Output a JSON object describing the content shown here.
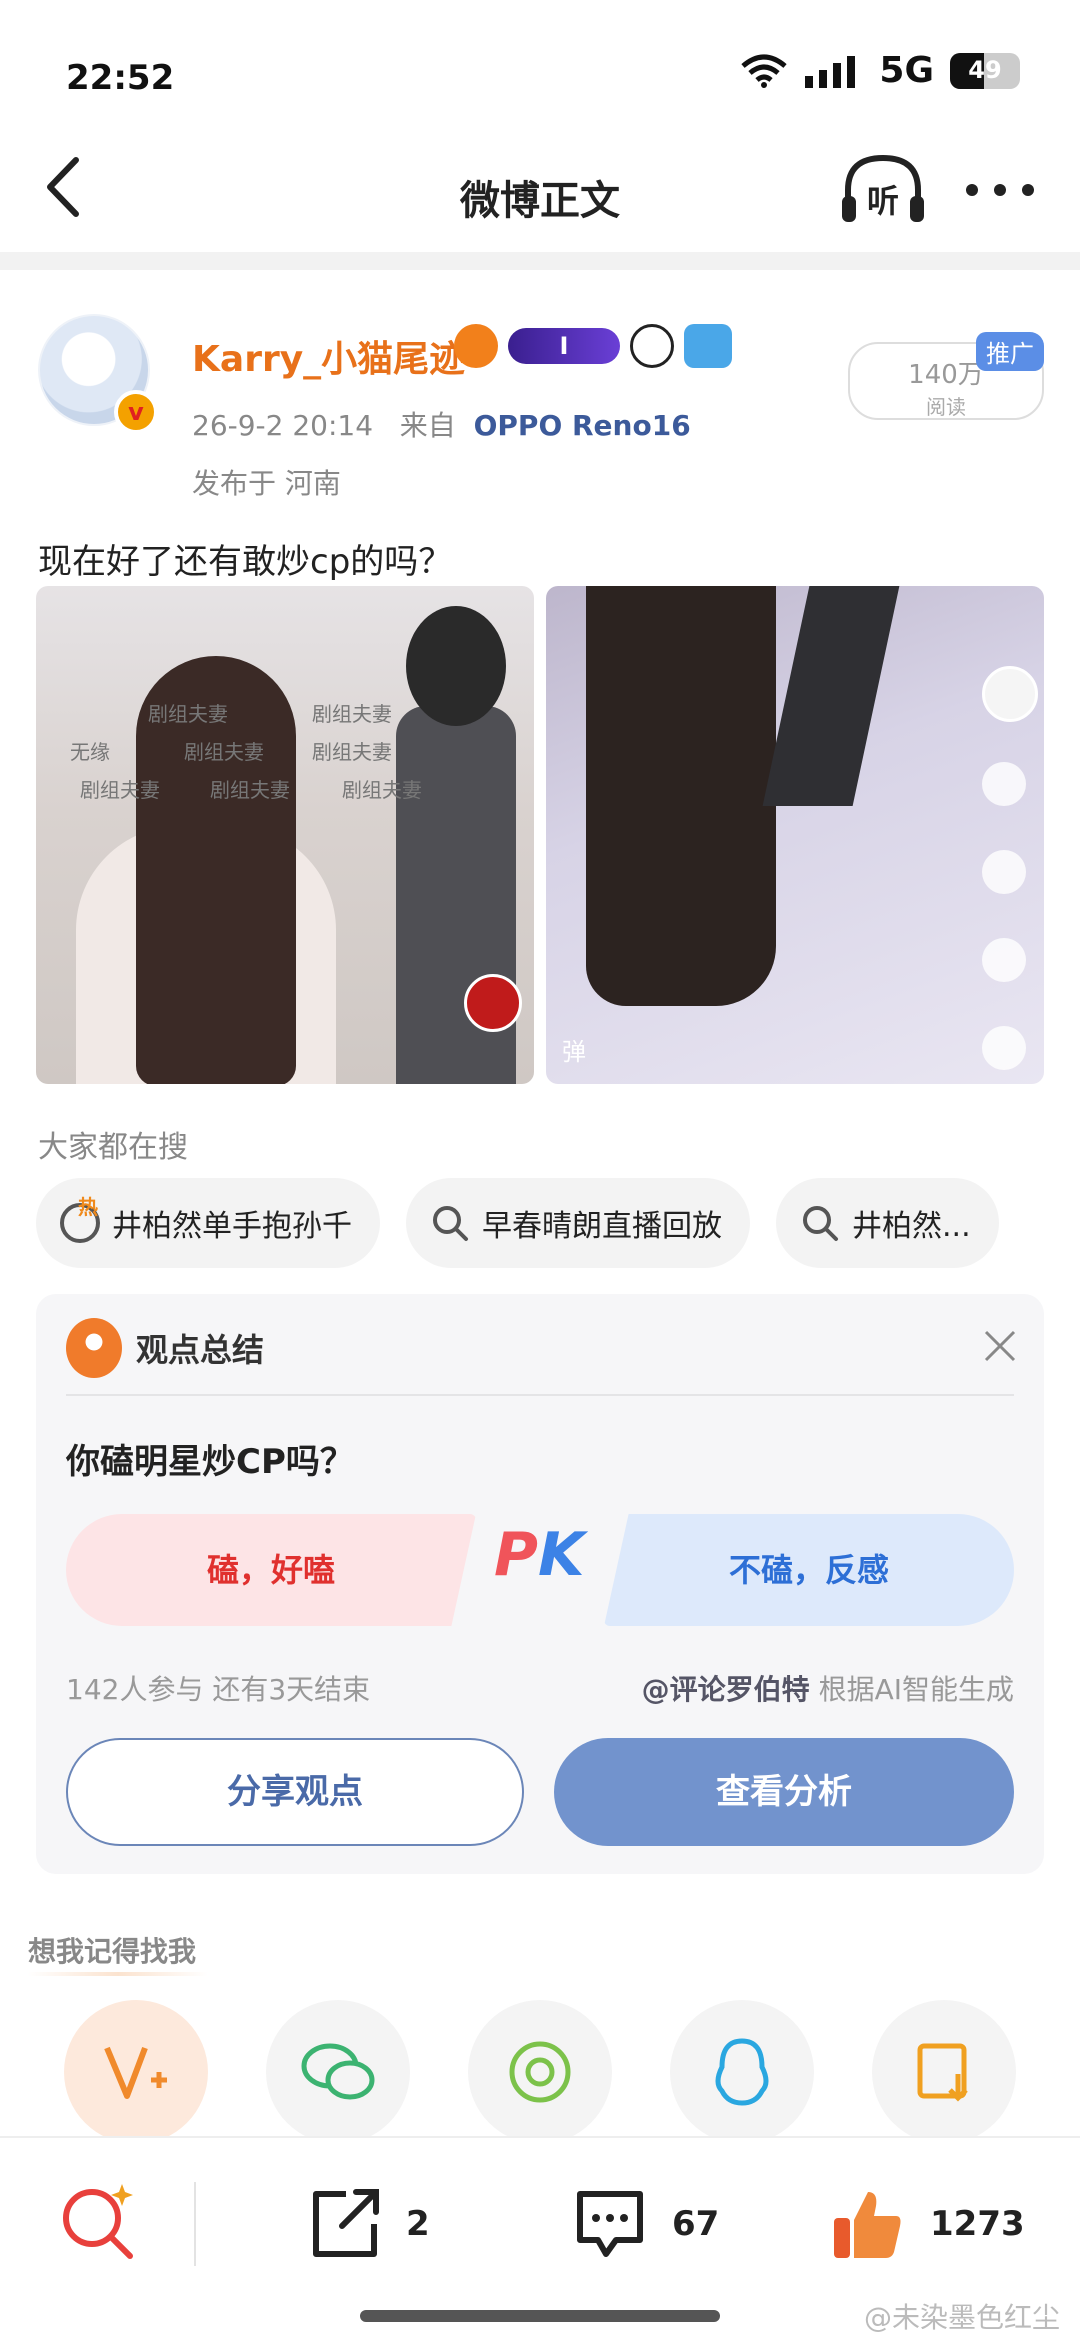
{
  "status": {
    "time": "22:52",
    "network": "5G",
    "battery": "49",
    "battery_level": 0.49
  },
  "nav": {
    "title": "微博正文",
    "listen_label": "听"
  },
  "post": {
    "username": "Karry_小猫尾迹",
    "badge_label": "I",
    "date": "26-9-2 20:14",
    "source_prefix": "来自",
    "device": "OPPO Reno16",
    "location": "发布于 河南",
    "promo_tag": "推广",
    "read_count": "140万",
    "read_label": "阅读",
    "text": "现在好了还有敢炒cp的吗？",
    "image_texts": [
      "剧组夫妻",
      "剧组夫妻",
      "剧组夫妻",
      "剧组夫妻",
      "无缘",
      "剧组夫妻",
      "剧组夫妻",
      "剧组夫妻"
    ],
    "image2_badge": "弹"
  },
  "search": {
    "label": "大家都在搜",
    "chips": [
      "井柏然单手抱孙千",
      "早春晴朗直播回放",
      "井柏然..."
    ]
  },
  "summary": {
    "title": "观点总结",
    "question": "你磕明星炒CP吗？",
    "option_left": "磕，好嗑",
    "pk_p": "P",
    "pk_k": "K",
    "option_right": "不磕，反感",
    "stats": "142人参与  还有3天结束",
    "ai_at": "@评论罗伯特",
    "ai_note": " 根据AI智能生成",
    "share_btn": "分享观点",
    "analysis_btn": "查看分析"
  },
  "remember": {
    "label": "想我记得找我"
  },
  "bottom": {
    "repost_count": "2",
    "comment_count": "67",
    "like_count": "1273"
  },
  "watermark": "@未染墨色红尘",
  "colors": {
    "accent_orange": "#e8711a",
    "link_blue": "#3c5a9a",
    "pk_red": "#e0302e",
    "pk_blue": "#2d6fd6",
    "analysis_btn": "#7293cd"
  }
}
